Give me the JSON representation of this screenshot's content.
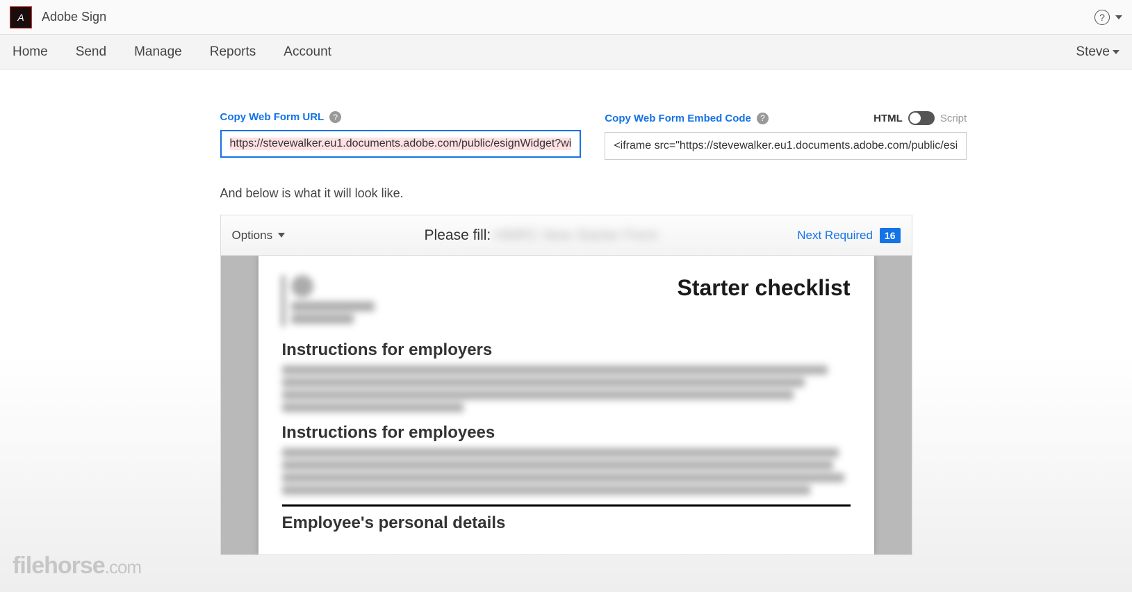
{
  "header": {
    "app_name": "Adobe Sign",
    "nav": [
      "Home",
      "Send",
      "Manage",
      "Reports",
      "Account"
    ],
    "user_name": "Steve"
  },
  "form": {
    "url_label": "Copy Web Form URL",
    "url_value": "https://stevewalker.eu1.documents.adobe.com/public/esignWidget?wi",
    "embed_label": "Copy Web Form Embed Code",
    "embed_value": "<iframe src=\"https://stevewalker.eu1.documents.adobe.com/public/esi",
    "toggle_left": "HTML",
    "toggle_right": "Script"
  },
  "description": "And below is what it will look like.",
  "preview": {
    "options_label": "Options",
    "fill_prefix": "Please fill:",
    "fill_name_blurred": "HMRC New Starter Form",
    "next_required_label": "Next Required",
    "required_count": "16"
  },
  "document": {
    "title": "Starter checklist",
    "section1": "Instructions for employers",
    "section2": "Instructions for employees",
    "section3": "Employee's personal details"
  },
  "watermark": {
    "name": "filehorse",
    "suffix": ".com"
  }
}
